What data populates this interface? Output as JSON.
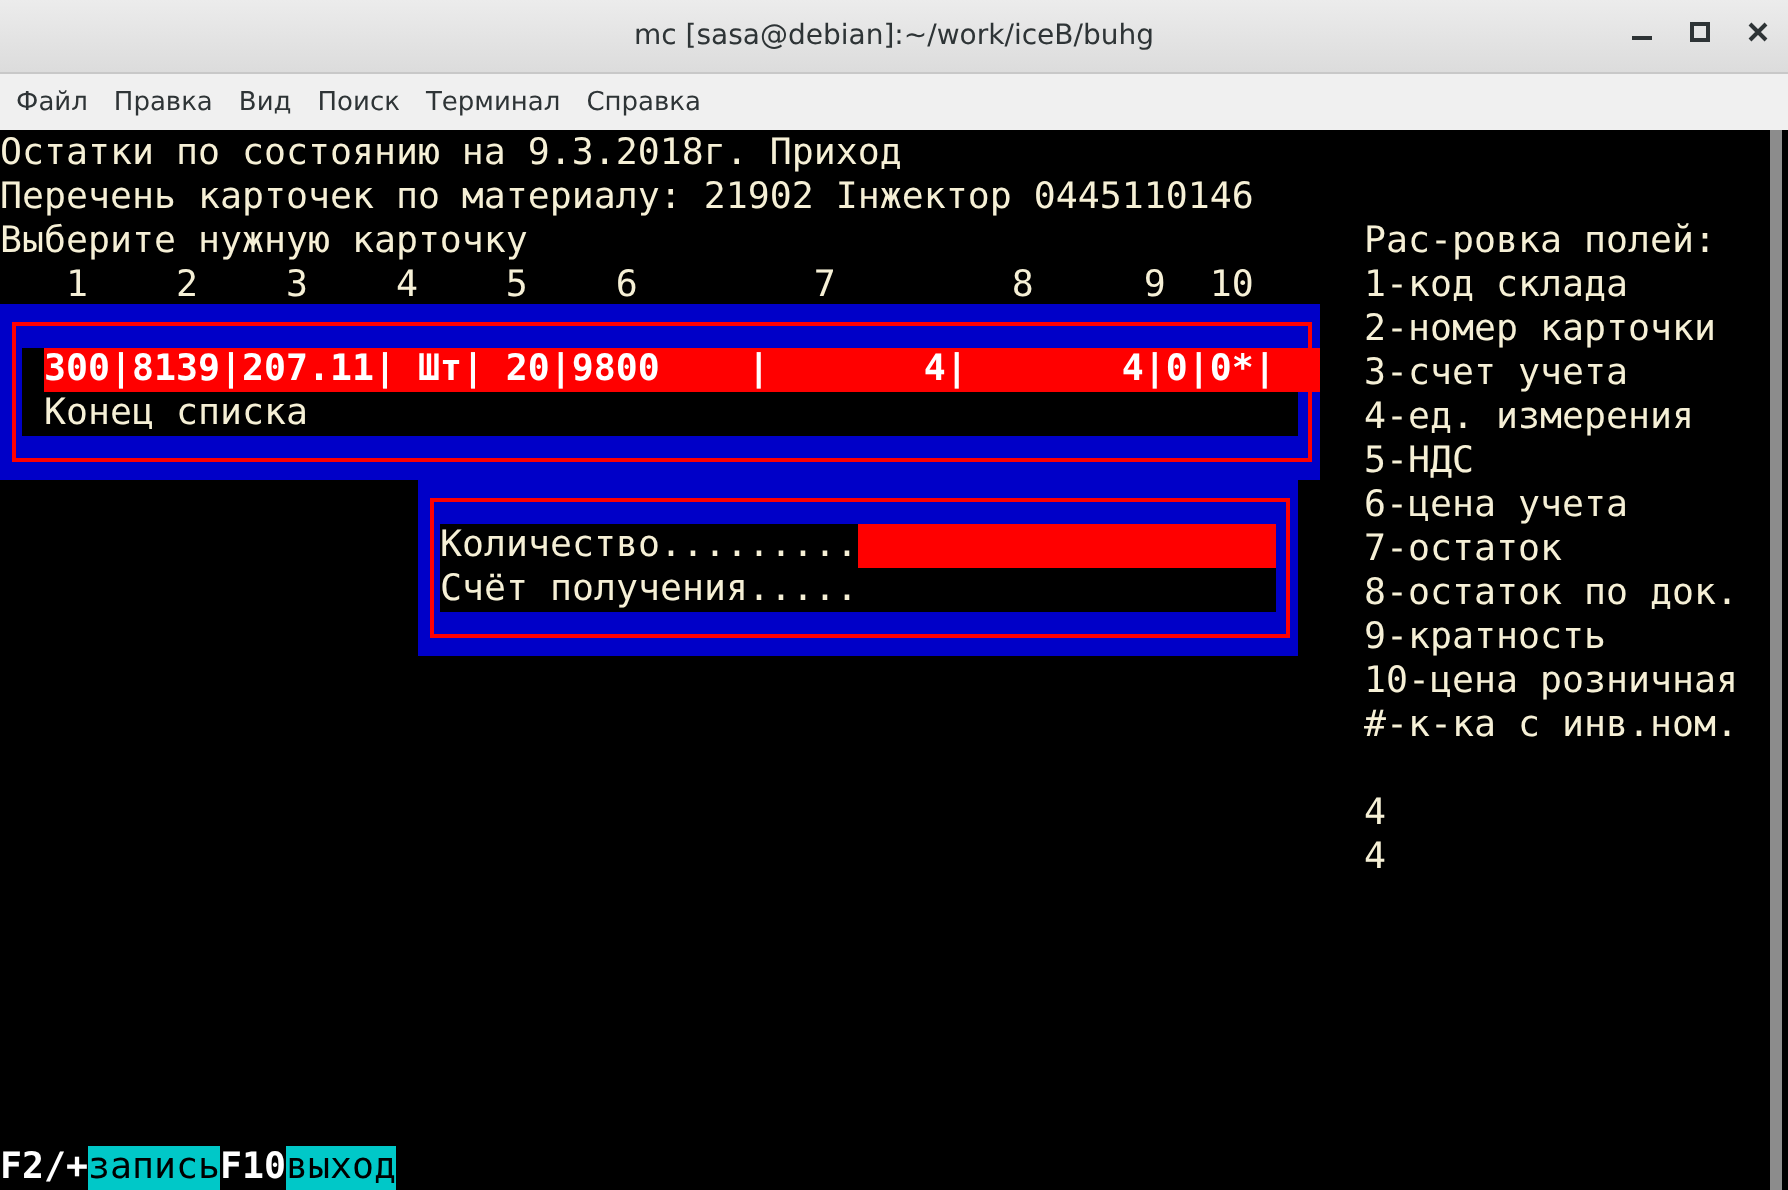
{
  "window": {
    "title": "mc [sasa@debian]:~/work/iceB/buhg"
  },
  "menu": [
    "Файл",
    "Правка",
    "Вид",
    "Поиск",
    "Терминал",
    "Справка"
  ],
  "terminal": {
    "header_lines": [
      "Остатки по состоянию на 9.3.2018г. Приход",
      "Перечень карточек по материалу: 21902 Інжектор 0445110146",
      "Выберите нужную карточку"
    ],
    "column_numbers": "   1    2    3    4    5    6        7        8     9  10",
    "legend": [
      "Рас-ровка полей:",
      "1-код склада",
      "2-номер карточки",
      "3-счет учета",
      "4-ед. измерения",
      "5-НДС",
      "6-цена учета",
      "7-остаток",
      "8-остаток по док.",
      "9-кратность",
      "10-цена розничная",
      "#-к-ка с инв.ном."
    ],
    "extra_lines": [
      "4",
      "4"
    ],
    "records": [
      {
        "text": "300|8139|207.11| Шт| 20|9800    |       4|       4|0|0*|",
        "selected": true
      }
    ],
    "list_end": "Конец списка",
    "form": {
      "fields": [
        {
          "label": "Количество.........",
          "focused": true
        },
        {
          "label": "Счёт получения.....",
          "focused": false
        }
      ]
    },
    "keys": [
      {
        "key": "F2/+",
        "label": "запись"
      },
      {
        "key": "F10",
        "label": "выход"
      }
    ]
  }
}
